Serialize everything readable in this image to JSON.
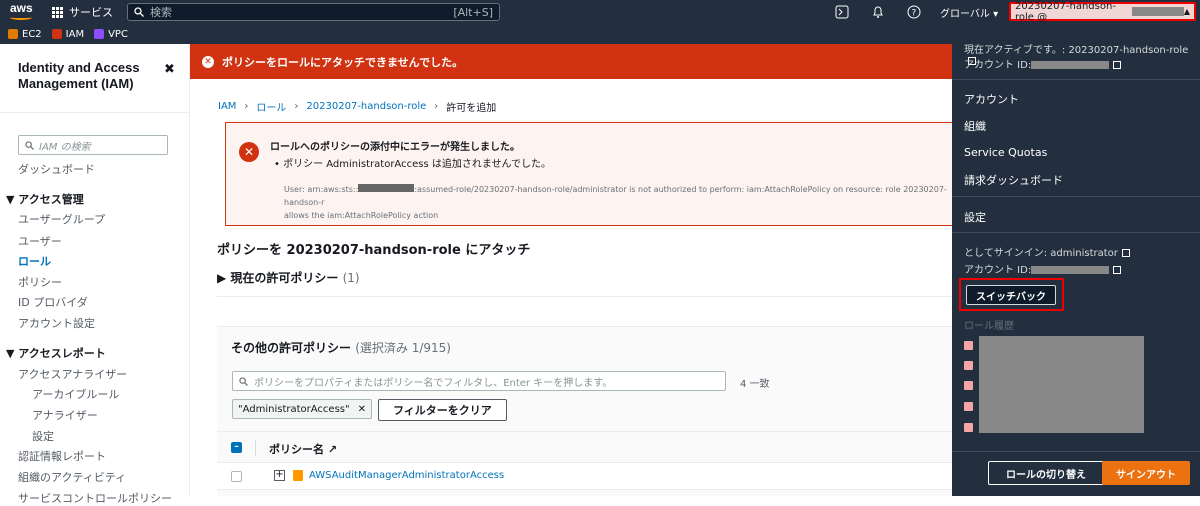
{
  "topnav": {
    "logo": "aws",
    "services": "サービス",
    "search_placeholder": "検索",
    "search_shortcut": "[Alt+S]",
    "region": "グローバル ▾",
    "account_label": "20230207-handson-role @"
  },
  "favorites": [
    {
      "label": "EC2",
      "color": "#e07b00"
    },
    {
      "label": "IAM",
      "color": "#d13212"
    },
    {
      "label": "VPC",
      "color": "#8c4fff"
    }
  ],
  "sidebar": {
    "title": "Identity and Access Management (IAM)",
    "search_placeholder": "IAM の検索",
    "dashboard": "ダッシュボード",
    "access_mgmt": "▼ アクセス管理",
    "items": [
      "ユーザーグループ",
      "ユーザー",
      "ロール",
      "ポリシー",
      "ID プロバイダ",
      "アカウント設定"
    ],
    "access_report": "▼ アクセスレポート",
    "report_items": [
      "アクセスアナライザー",
      "アーカイブルール",
      "アナライザー",
      "設定",
      "認証情報レポート",
      "組織のアクティビティ",
      "サービスコントロールポリシー"
    ]
  },
  "error_banner": "ポリシーをロールにアタッチできませんでした。",
  "breadcrumb": [
    "IAM",
    "ロール",
    "20230207-handson-role",
    "許可を追加"
  ],
  "error_box": {
    "heading": "ロールへのポリシーの添付中にエラーが発生しました。",
    "item": "ポリシー AdministratorAccess は追加されませんでした。",
    "detail_a": "User: arn:aws:sts::",
    "detail_b": ":assumed-role/20230207-handson-role/administrator is not authorized to perform: iam:AttachRolePolicy on resource: role 20230207-handson-r",
    "detail_c": "allows the iam:AttachRolePolicy action"
  },
  "page_title": "ポリシーを 20230207-handson-role にアタッチ",
  "current_policies": {
    "label": "現在の許可ポリシー",
    "count": "(1)"
  },
  "other_policies": {
    "label": "その他の許可ポリシー",
    "selected": "(選択済み 1/915)",
    "filter_placeholder": "ポリシーをプロパティまたはポリシー名でフィルタし、Enter キーを押します。",
    "matches": "4 一致",
    "token": "\"AdministratorAccess\"",
    "clear": "フィルターをクリア",
    "col_name": "ポリシー名",
    "rows": [
      "AWSAuditManagerAdministratorAccess"
    ]
  },
  "account_menu": {
    "active_label": "現在アクティブです。: 20230207-handson-role",
    "account_id_label": "アカウント ID:",
    "links": [
      "アカウント",
      "組織",
      "Service Quotas",
      "請求ダッシュボード"
    ],
    "settings": "設定",
    "signed_in": "としてサインイン: administrator",
    "account_id_label2": "アカウント ID:",
    "switch_back": "スイッチバック",
    "role_history": "ロール履歴",
    "switch_role": "ロールの切り替え",
    "sign_out": "サインアウト"
  }
}
